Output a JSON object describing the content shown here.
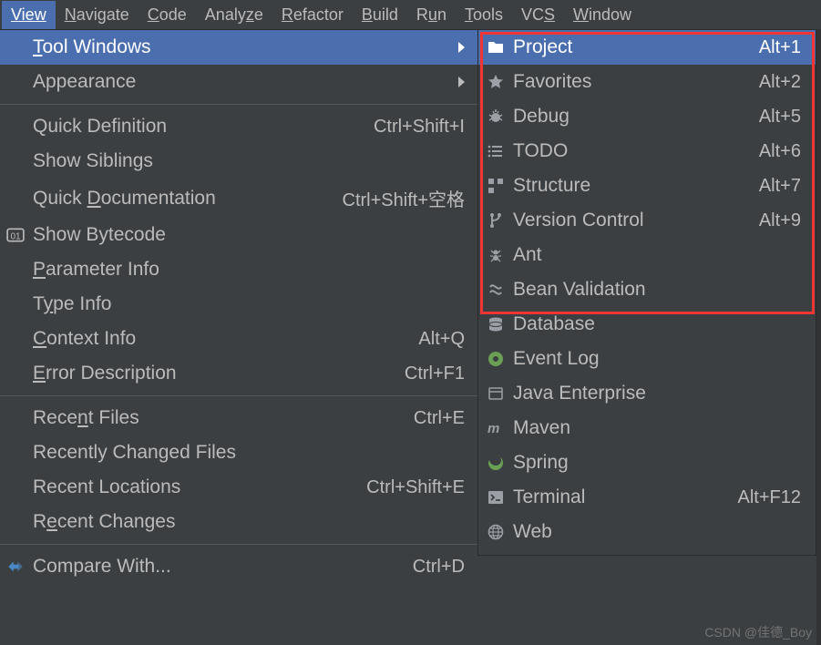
{
  "menubar": {
    "items": [
      {
        "label": "View",
        "mnemonic": 0,
        "active": true
      },
      {
        "label": "Navigate",
        "mnemonic": 0
      },
      {
        "label": "Code",
        "mnemonic": 0
      },
      {
        "label": "Analyze",
        "mnemonic": 6
      },
      {
        "label": "Refactor",
        "mnemonic": 0
      },
      {
        "label": "Build",
        "mnemonic": 0
      },
      {
        "label": "Run",
        "mnemonic": 1
      },
      {
        "label": "Tools",
        "mnemonic": 0
      },
      {
        "label": "VCS",
        "mnemonic": 2
      },
      {
        "label": "Window",
        "mnemonic": 0
      }
    ]
  },
  "view_menu": [
    {
      "type": "item",
      "label": "Tool Windows",
      "mnemonic": 0,
      "submenu": true,
      "highlight": true
    },
    {
      "type": "item",
      "label": "Appearance",
      "submenu": true
    },
    {
      "type": "sep"
    },
    {
      "type": "item",
      "label": "Quick Definition",
      "shortcut": "Ctrl+Shift+I"
    },
    {
      "type": "item",
      "label": "Show Siblings"
    },
    {
      "type": "item",
      "label": "Quick Documentation",
      "mnemonic": 6,
      "shortcut": "Ctrl+Shift+空格"
    },
    {
      "type": "item",
      "label": "Show Bytecode",
      "left_icon": "bytecode"
    },
    {
      "type": "item",
      "label": "Parameter Info",
      "mnemonic": 0
    },
    {
      "type": "item",
      "label": "Type Info",
      "mnemonic": 1
    },
    {
      "type": "item",
      "label": "Context Info",
      "mnemonic": 0,
      "shortcut": "Alt+Q"
    },
    {
      "type": "item",
      "label": "Error Description",
      "mnemonic": 0,
      "shortcut": "Ctrl+F1"
    },
    {
      "type": "sep"
    },
    {
      "type": "item",
      "label": "Recent Files",
      "mnemonic": 4,
      "shortcut": "Ctrl+E"
    },
    {
      "type": "item",
      "label": "Recently Changed Files"
    },
    {
      "type": "item",
      "label": "Recent Locations",
      "shortcut": "Ctrl+Shift+E"
    },
    {
      "type": "item",
      "label": "Recent Changes",
      "mnemonic": 1
    },
    {
      "type": "sep"
    },
    {
      "type": "item",
      "label": "Compare With...",
      "left_icon": "compare",
      "shortcut": "Ctrl+D"
    }
  ],
  "tool_windows": [
    {
      "label": "Project",
      "shortcut": "Alt+1",
      "icon": "folder",
      "highlight": true
    },
    {
      "label": "Favorites",
      "shortcut": "Alt+2",
      "icon": "star"
    },
    {
      "label": "Debug",
      "shortcut": "Alt+5",
      "icon": "bug"
    },
    {
      "label": "TODO",
      "shortcut": "Alt+6",
      "icon": "list"
    },
    {
      "label": "Structure",
      "shortcut": "Alt+7",
      "icon": "structure"
    },
    {
      "label": "Version Control",
      "shortcut": "Alt+9",
      "icon": "branch"
    },
    {
      "label": "Ant",
      "icon": "ant"
    },
    {
      "label": "Bean Validation",
      "icon": "bean"
    },
    {
      "label": "Database",
      "icon": "database"
    },
    {
      "label": "Event Log",
      "icon": "eventlog"
    },
    {
      "label": "Java Enterprise",
      "icon": "javaee"
    },
    {
      "label": "Maven",
      "icon": "maven"
    },
    {
      "label": "Spring",
      "icon": "spring"
    },
    {
      "label": "Terminal",
      "shortcut": "Alt+F12",
      "icon": "terminal"
    },
    {
      "label": "Web",
      "icon": "web"
    }
  ],
  "watermark": "CSDN @佳德_Boy"
}
